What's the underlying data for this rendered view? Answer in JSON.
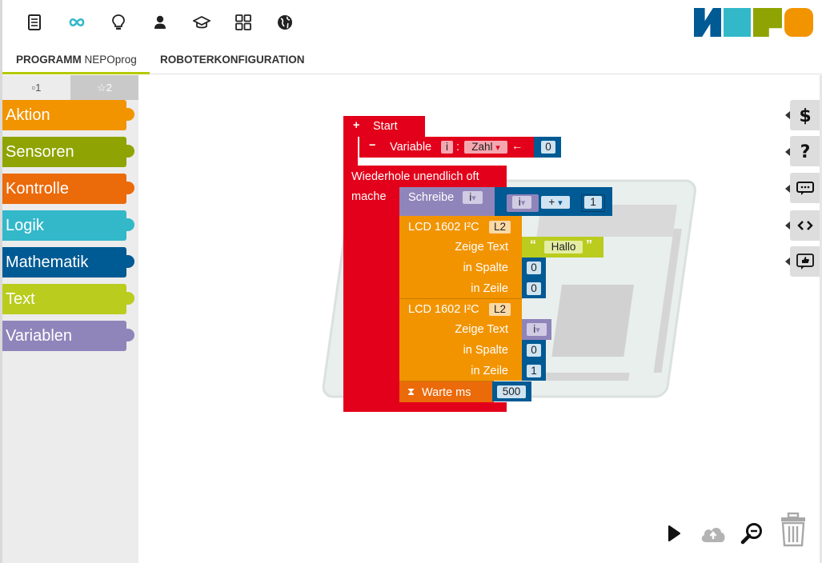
{
  "topbar": {
    "icons": [
      "document-icon",
      "infinity-icon",
      "lightbulb-icon",
      "user-icon",
      "graduation-cap-icon",
      "grid-icon",
      "globe-icon"
    ],
    "logo": {
      "text": "NEPO",
      "colors": [
        "#005a94",
        "#33b8ca",
        "#8fa402",
        "#f29400"
      ]
    }
  },
  "tabs": {
    "program_bold": "PROGRAMM",
    "program_thin": "NEPOprog",
    "robot": "ROBOTERKONFIGURATION"
  },
  "toolbox": {
    "level1": "▫1",
    "level2": "☆2",
    "categories": [
      {
        "label": "Aktion",
        "color": "#f29400"
      },
      {
        "label": "Sensoren",
        "color": "#8fa402"
      },
      {
        "label": "Kontrolle",
        "color": "#eb6a0a"
      },
      {
        "label": "Logik",
        "color": "#33b8ca"
      },
      {
        "label": "Mathematik",
        "color": "#005a94"
      },
      {
        "label": "Text",
        "color": "#bacc1e"
      },
      {
        "label": "Variablen",
        "color": "#9085ba"
      }
    ]
  },
  "blocks": {
    "start": "Start",
    "variable": "Variable",
    "var_name": "i",
    "colon": ":",
    "var_type": "Zahl",
    "arrow": "←",
    "init_value": "0",
    "repeat": "Wiederhole unendlich oft",
    "do": "mache",
    "write": "Schreibe",
    "write_var": "i",
    "op_var": "i",
    "op": "+",
    "op_value": "1",
    "lcd1": "LCD 1602 I²C",
    "lcd1_port": "L2",
    "show_text": "Zeige Text",
    "text_value": "Hallo",
    "quote_open": "“",
    "quote_close": "”",
    "in_column": "in Spalte",
    "col1": "0",
    "in_row": "in Zeile",
    "row1": "0",
    "lcd2": "LCD 1602 I²C",
    "lcd2_port": "L2",
    "show_text2": "Zeige Text",
    "text_var2": "i",
    "in_column2": "in Spalte",
    "col2": "0",
    "in_row2": "in Zeile",
    "row2": "1",
    "wait": "Warte ms",
    "wait_value": "500",
    "dropdown": "▾"
  },
  "colors": {
    "control_red": "#e2001a",
    "variable_purple": "#9085ba",
    "math_blue": "#005a94",
    "action_orange": "#f29400",
    "text_lime": "#bacc1e",
    "tab_accent": "#b5c900"
  },
  "side_tools": [
    "dollar-icon",
    "help-icon",
    "comment-icon",
    "code-icon",
    "thumbs-up-icon"
  ],
  "bottom_tools": [
    "run-icon",
    "upload-cloud-icon",
    "zoom-icon",
    "trash-icon"
  ]
}
